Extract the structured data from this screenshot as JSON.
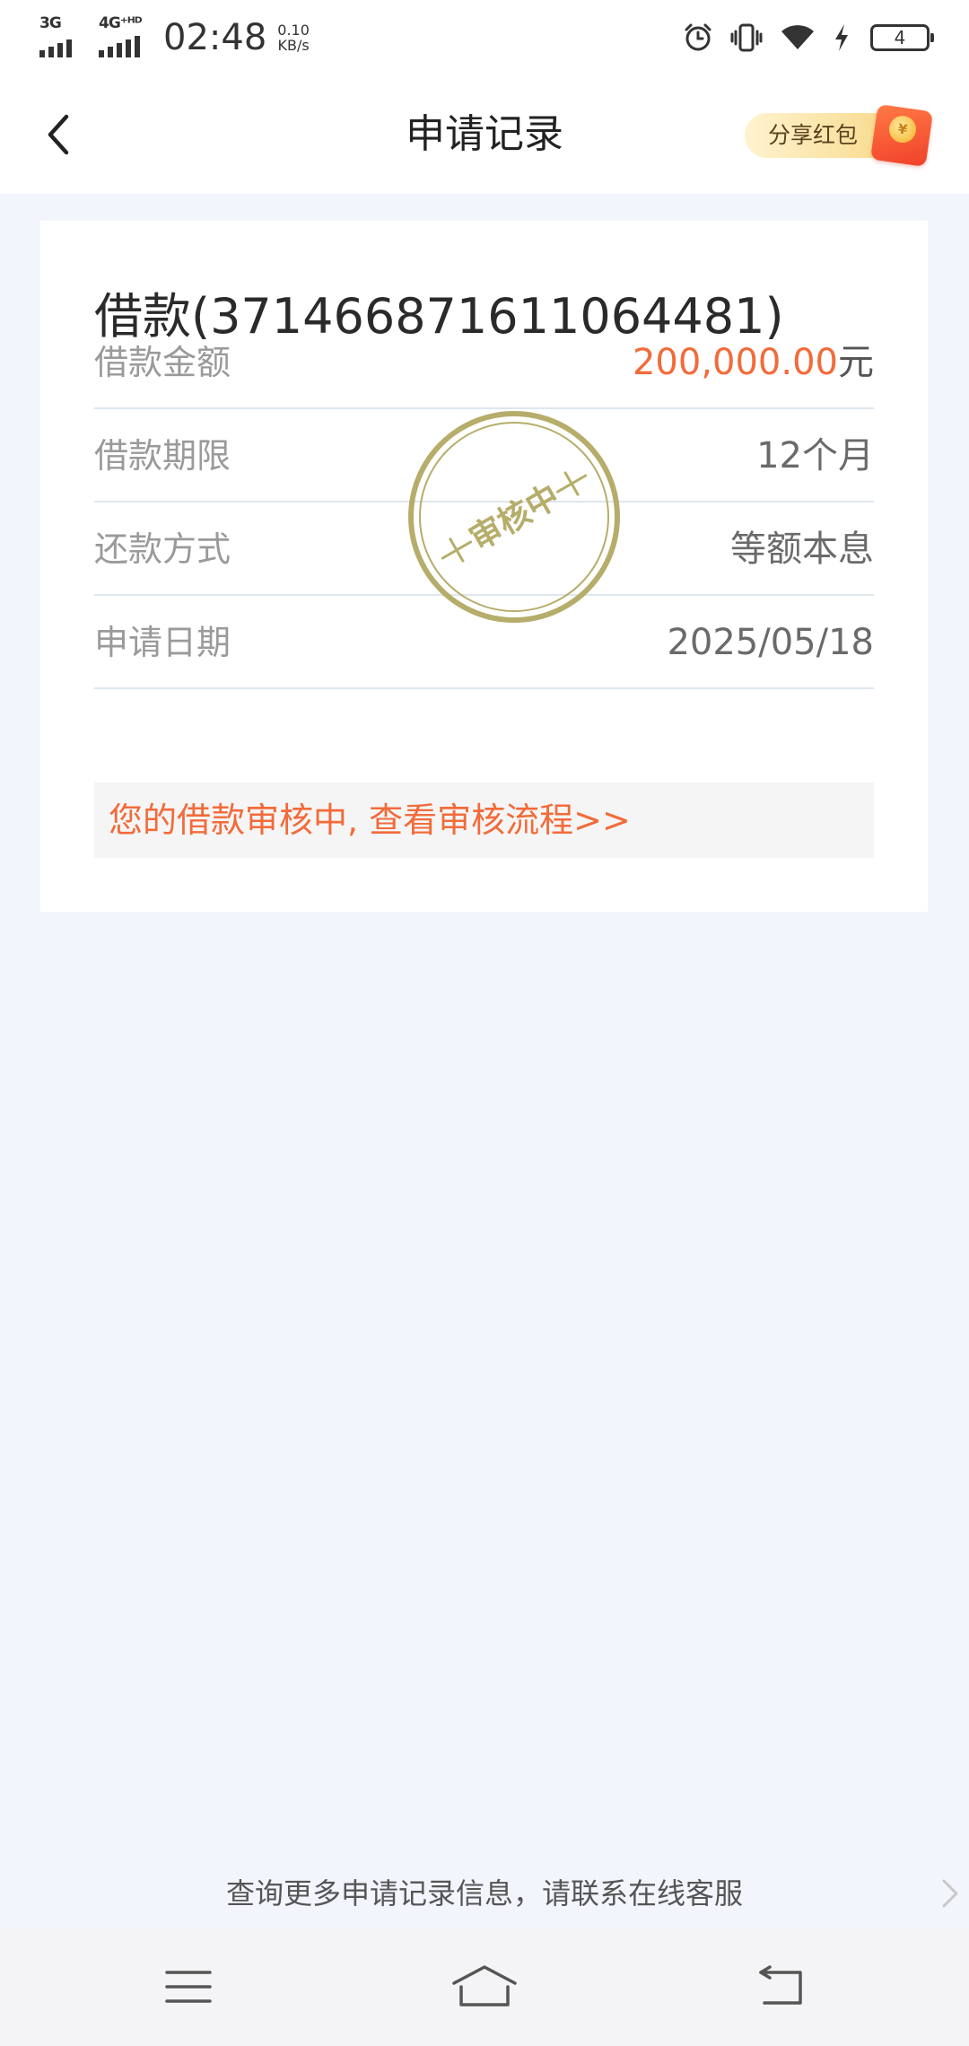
{
  "status_bar": {
    "network_1": "3G",
    "network_2": "4G⁺ᴴᴰ",
    "time": "02:48",
    "speed_value": "0.10",
    "speed_unit": "KB/s",
    "battery_level": "4",
    "icons": [
      "alarm-icon",
      "vibrate-icon",
      "wifi-icon",
      "charging-icon",
      "battery-icon"
    ]
  },
  "nav": {
    "title": "申请记录",
    "share_label": "分享红包",
    "coin_glyph": "¥"
  },
  "card": {
    "title": "借款(371466871611064481)",
    "rows": [
      {
        "label": "借款金额",
        "amount": "200,000.00",
        "unit": "元"
      },
      {
        "label": "借款期限",
        "value": "12个月"
      },
      {
        "label": "还款方式",
        "value": "等额本息"
      },
      {
        "label": "申请日期",
        "value": "2025/05/18"
      }
    ],
    "stamp_text": "审核中",
    "notice": "您的借款审核中, 查看审核流程>>"
  },
  "footer": {
    "text": "查询更多申请记录信息，请联系在线客服"
  },
  "colors": {
    "accent": "#f26b3a",
    "stamp": "#b6ad6a",
    "page_bg": "#f2f5fc"
  }
}
